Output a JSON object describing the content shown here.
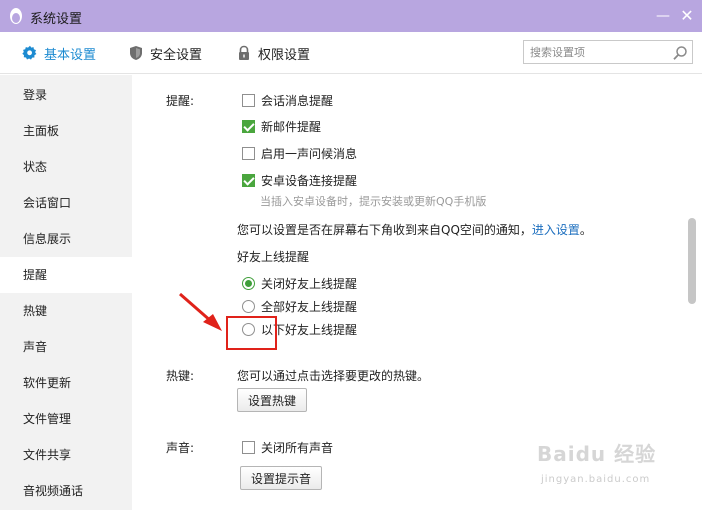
{
  "window": {
    "title": "系统设置",
    "min_label": "—",
    "close_label": "✕"
  },
  "tabs": [
    {
      "label": "基本设置",
      "icon": "gear-icon",
      "active": true
    },
    {
      "label": "安全设置",
      "icon": "shield-icon",
      "active": false
    },
    {
      "label": "权限设置",
      "icon": "lock-icon",
      "active": false
    }
  ],
  "search": {
    "placeholder": "搜索设置项",
    "value": ""
  },
  "sidebar": {
    "items": [
      {
        "label": "登录"
      },
      {
        "label": "主面板"
      },
      {
        "label": "状态"
      },
      {
        "label": "会话窗口"
      },
      {
        "label": "信息展示"
      },
      {
        "label": "提醒",
        "active": true
      },
      {
        "label": "热键"
      },
      {
        "label": "声音"
      },
      {
        "label": "软件更新"
      },
      {
        "label": "文件管理"
      },
      {
        "label": "文件共享"
      },
      {
        "label": "音视频通话"
      }
    ]
  },
  "reminder": {
    "label": "提醒:",
    "options": [
      {
        "label": "会话消息提醒",
        "checked": false
      },
      {
        "label": "新邮件提醒",
        "checked": true
      },
      {
        "label": "启用一声问候消息",
        "checked": false
      },
      {
        "label": "安卓设备连接提醒",
        "checked": true
      }
    ],
    "android_hint": "当插入安卓设备时，提示安装或更新QQ手机版",
    "qzone_text": "您可以设置是否在屏幕右下角收到来自QQ空间的通知，",
    "qzone_link": "进入设置",
    "qzone_period": "。",
    "friend_online_title": "好友上线提醒",
    "friend_options": [
      {
        "label": "关闭好友上线提醒",
        "selected": true
      },
      {
        "label": "全部好友上线提醒",
        "selected": false
      },
      {
        "label": "以下好友上线提醒",
        "selected": false
      }
    ]
  },
  "hotkey": {
    "label": "热键:",
    "desc": "您可以通过点击选择要更改的热键。",
    "button": "设置热键"
  },
  "sound": {
    "label": "声音:",
    "mute_all": "关闭所有声音",
    "mute_checked": false,
    "button": "设置提示音"
  },
  "watermark": {
    "main": "Baidu 经验",
    "sub": "jingyan.baidu.com"
  },
  "colors": {
    "titlebar": "#b8a6e0",
    "accent": "#1d8bd1",
    "check_green": "#4aa63e",
    "annotation_red": "#e0221a"
  }
}
